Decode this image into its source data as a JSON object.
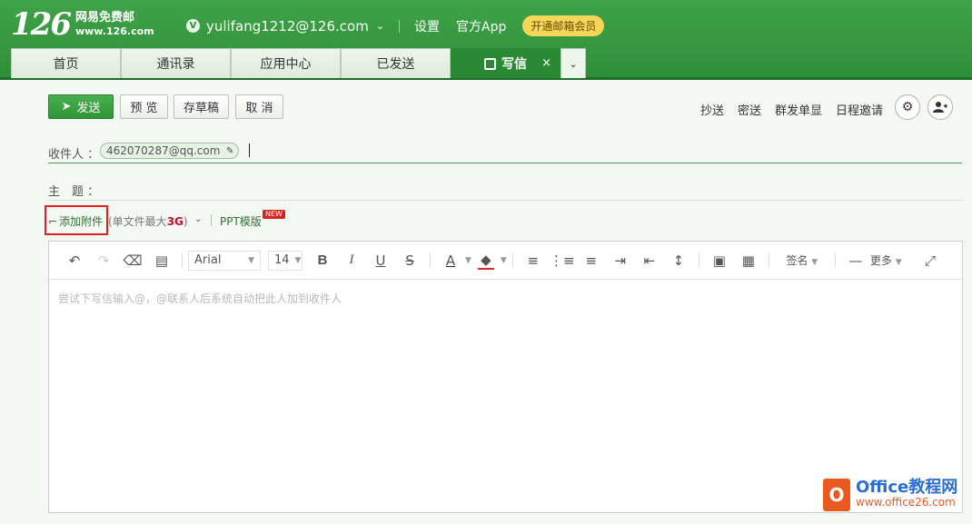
{
  "header": {
    "logo_num": "126",
    "logo_cn": "网易免费邮",
    "logo_url": "www.126.com",
    "account_badge": "V",
    "account": "yulifang1212@126.com",
    "settings": "设置",
    "app": "官方App",
    "vip": "开通邮箱会员"
  },
  "tabs": [
    {
      "label": "首页"
    },
    {
      "label": "通讯录"
    },
    {
      "label": "应用中心"
    },
    {
      "label": "已发送"
    },
    {
      "label": "写信",
      "close": "×"
    }
  ],
  "toolbar": {
    "send": "发送",
    "preview": "预 览",
    "draft": "存草稿",
    "cancel": "取 消",
    "cc": "抄送",
    "bcc": "密送",
    "separate": "群发单显",
    "calendar": "日程邀请"
  },
  "recipients": {
    "label": "收件人 ：",
    "chip": "462070287@qq.com"
  },
  "subject": {
    "label": "主　题 ："
  },
  "attachment": {
    "add": "添加附件",
    "note_prefix": "(单文件最大",
    "note_size": "3G",
    "note_suffix": ")",
    "ppt": "PPT模版",
    "new_badge": "NEW"
  },
  "editor": {
    "font": "Arial",
    "size": "14",
    "signature": "签名",
    "more": "更多",
    "placeholder": "尝试下写信输入@，@联系人后系统自动把此人加到收件人"
  },
  "watermark": {
    "title": "Office教程网",
    "url": "www.office26.com"
  },
  "colors": {
    "brand_green": "#2e8f39",
    "highlight_red": "#e02020"
  }
}
